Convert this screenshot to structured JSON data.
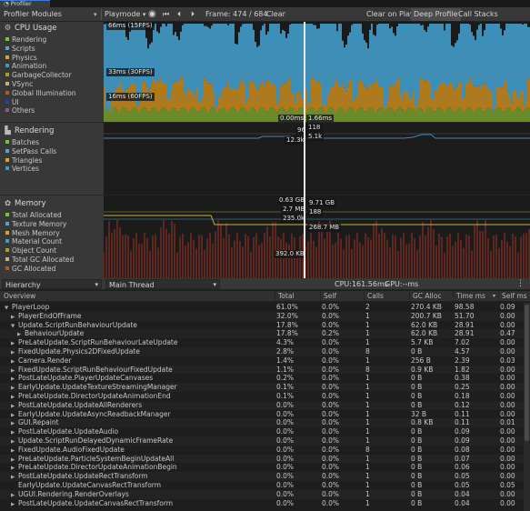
{
  "window": {
    "tab_title": "Profiler"
  },
  "toolbar": {
    "modules_label": "Profiler Modules",
    "mode_label": "Playmode",
    "frame_label": "Frame: 474 / 684",
    "clear_label": "Clear",
    "clear_on_play_label": "Clear on Play",
    "deep_profile_label": "Deep Profile",
    "call_stacks_label": "Call Stacks"
  },
  "modules": {
    "cpu": {
      "title": "CPU Usage",
      "legend": [
        {
          "label": "Rendering",
          "color": "#7fbf3f"
        },
        {
          "label": "Scripts",
          "color": "#5aa0d8"
        },
        {
          "label": "Physics",
          "color": "#d6a23a"
        },
        {
          "label": "Animation",
          "color": "#3a9fb5"
        },
        {
          "label": "GarbageCollector",
          "color": "#a7a02b"
        },
        {
          "label": "VSync",
          "color": "#c9b27a"
        },
        {
          "label": "Global Illumination",
          "color": "#b2582e"
        },
        {
          "label": "UI",
          "color": "#2c3f9e"
        },
        {
          "label": "Others",
          "color": "#8b5a8b"
        }
      ]
    },
    "rendering": {
      "title": "Rendering",
      "legend": [
        {
          "label": "Batches",
          "color": "#7fbf3f"
        },
        {
          "label": "SetPass Calls",
          "color": "#5aa0d8"
        },
        {
          "label": "Triangles",
          "color": "#d6a23a"
        },
        {
          "label": "Vertices",
          "color": "#3a9fb5"
        }
      ]
    },
    "memory": {
      "title": "Memory",
      "legend": [
        {
          "label": "Total Allocated",
          "color": "#7fbf3f"
        },
        {
          "label": "Texture Memory",
          "color": "#5aa0d8"
        },
        {
          "label": "Mesh Memory",
          "color": "#d6a23a"
        },
        {
          "label": "Material Count",
          "color": "#3a9fb5"
        },
        {
          "label": "Object Count",
          "color": "#a7a02b"
        },
        {
          "label": "Total GC Allocated",
          "color": "#c9b27a"
        },
        {
          "label": "GC Allocated",
          "color": "#b2582e"
        }
      ]
    }
  },
  "cpu_graph": {
    "lines": [
      "66ms (15FPS)",
      "33ms (30FPS)",
      "16ms (60FPS)"
    ],
    "selection": [
      "0.00ms",
      "1.66ms"
    ]
  },
  "rendering_graph": {
    "labels": [
      "96",
      "118",
      "12.3k",
      "5.1k"
    ]
  },
  "memory_graph": {
    "labels": [
      "0.63 GB",
      "9.71 GB",
      "2.7 MB",
      "188",
      "235.0k",
      "268.7 MB",
      "392.0 KB"
    ]
  },
  "colors": {
    "cpu_scripts": "#3d8fb8",
    "cpu_physics": "#b07a1a",
    "cpu_rendering": "#6b8a2a",
    "rendering_line": "#3f8ab0",
    "memory_line_yellow": "#c2b640",
    "memory_gc": "#b03a26"
  },
  "bottom_toolbar": {
    "view_label": "Hierarchy",
    "thread_label": "Main Thread",
    "cpu_text": "CPU:161.56ms",
    "gpu_text": "GPU:--ms"
  },
  "table": {
    "headers": [
      "Overview",
      "Total",
      "Self",
      "Calls",
      "GC Alloc",
      "Time ms",
      "Self ms"
    ],
    "rows": [
      {
        "name": "PlayerLoop",
        "indent": 0,
        "arrow": "▼",
        "total": "61.0%",
        "self": "0.0%",
        "calls": "2",
        "gc": "270.4 KB",
        "time": "98.58",
        "selfms": "0.09"
      },
      {
        "name": "PlayerEndOfFrame",
        "indent": 1,
        "arrow": "▶",
        "total": "32.0%",
        "self": "0.0%",
        "calls": "1",
        "gc": "200.7 KB",
        "time": "51.70",
        "selfms": "0.00"
      },
      {
        "name": "Update.ScriptRunBehaviourUpdate",
        "indent": 1,
        "arrow": "▼",
        "total": "17.8%",
        "self": "0.0%",
        "calls": "1",
        "gc": "62.0 KB",
        "time": "28.91",
        "selfms": "0.00"
      },
      {
        "name": "BehaviourUpdate",
        "indent": 2,
        "arrow": "▶",
        "total": "17.8%",
        "self": "0.2%",
        "calls": "1",
        "gc": "62.0 KB",
        "time": "28.91",
        "selfms": "0.47"
      },
      {
        "name": "PreLateUpdate.ScriptRunBehaviourLateUpdate",
        "indent": 1,
        "arrow": "▶",
        "total": "4.3%",
        "self": "0.0%",
        "calls": "1",
        "gc": "5.7 KB",
        "time": "7.02",
        "selfms": "0.00"
      },
      {
        "name": "FixedUpdate.Physics2DFixedUpdate",
        "indent": 1,
        "arrow": "▶",
        "total": "2.8%",
        "self": "0.0%",
        "calls": "8",
        "gc": "0 B",
        "time": "4.57",
        "selfms": "0.00"
      },
      {
        "name": "Camera.Render",
        "indent": 1,
        "arrow": "▶",
        "total": "1.4%",
        "self": "0.0%",
        "calls": "1",
        "gc": "256 B",
        "time": "2.39",
        "selfms": "0.03"
      },
      {
        "name": "FixedUpdate.ScriptRunBehaviourFixedUpdate",
        "indent": 1,
        "arrow": "▶",
        "total": "1.1%",
        "self": "0.0%",
        "calls": "8",
        "gc": "0.9 KB",
        "time": "1.82",
        "selfms": "0.00"
      },
      {
        "name": "PostLateUpdate.PlayerUpdateCanvases",
        "indent": 1,
        "arrow": "▶",
        "total": "0.2%",
        "self": "0.0%",
        "calls": "1",
        "gc": "0 B",
        "time": "0.38",
        "selfms": "0.00"
      },
      {
        "name": "EarlyUpdate.UpdateTextureStreamingManager",
        "indent": 1,
        "arrow": "▶",
        "total": "0.1%",
        "self": "0.0%",
        "calls": "1",
        "gc": "0 B",
        "time": "0.25",
        "selfms": "0.00"
      },
      {
        "name": "PreLateUpdate.DirectorUpdateAnimationEnd",
        "indent": 1,
        "arrow": "▶",
        "total": "0.1%",
        "self": "0.0%",
        "calls": "1",
        "gc": "0 B",
        "time": "0.18",
        "selfms": "0.00"
      },
      {
        "name": "PostLateUpdate.UpdateAllRenderers",
        "indent": 1,
        "arrow": "▶",
        "total": "0.0%",
        "self": "0.0%",
        "calls": "1",
        "gc": "0 B",
        "time": "0.12",
        "selfms": "0.00"
      },
      {
        "name": "EarlyUpdate.UpdateAsyncReadbackManager",
        "indent": 1,
        "arrow": "▶",
        "total": "0.0%",
        "self": "0.0%",
        "calls": "1",
        "gc": "32 B",
        "time": "0.11",
        "selfms": "0.00"
      },
      {
        "name": "GUI.Repaint",
        "indent": 1,
        "arrow": "▶",
        "total": "0.0%",
        "self": "0.0%",
        "calls": "1",
        "gc": "0.8 KB",
        "time": "0.11",
        "selfms": "0.01"
      },
      {
        "name": "PostLateUpdate.UpdateAudio",
        "indent": 1,
        "arrow": "▶",
        "total": "0.0%",
        "self": "0.0%",
        "calls": "1",
        "gc": "0 B",
        "time": "0.09",
        "selfms": "0.00"
      },
      {
        "name": "Update.ScriptRunDelayedDynamicFrameRate",
        "indent": 1,
        "arrow": "▶",
        "total": "0.0%",
        "self": "0.0%",
        "calls": "1",
        "gc": "0 B",
        "time": "0.09",
        "selfms": "0.00"
      },
      {
        "name": "FixedUpdate.AudioFixedUpdate",
        "indent": 1,
        "arrow": "▶",
        "total": "0.0%",
        "self": "0.0%",
        "calls": "8",
        "gc": "0 B",
        "time": "0.08",
        "selfms": "0.00"
      },
      {
        "name": "PreLateUpdate.ParticleSystemBeginUpdateAll",
        "indent": 1,
        "arrow": "▶",
        "total": "0.0%",
        "self": "0.0%",
        "calls": "1",
        "gc": "0 B",
        "time": "0.07",
        "selfms": "0.00"
      },
      {
        "name": "PreLateUpdate.DirectorUpdateAnimationBegin",
        "indent": 1,
        "arrow": "▶",
        "total": "0.0%",
        "self": "0.0%",
        "calls": "1",
        "gc": "0 B",
        "time": "0.06",
        "selfms": "0.00"
      },
      {
        "name": "PostLateUpdate.UpdateRectTransform",
        "indent": 1,
        "arrow": "▶",
        "total": "0.0%",
        "self": "0.0%",
        "calls": "1",
        "gc": "0 B",
        "time": "0.05",
        "selfms": "0.00"
      },
      {
        "name": "EarlyUpdate.UpdateCanvasRectTransform",
        "indent": 1,
        "arrow": "",
        "total": "0.0%",
        "self": "0.0%",
        "calls": "1",
        "gc": "0 B",
        "time": "0.05",
        "selfms": "0.05"
      },
      {
        "name": "UGUI.Rendering.RenderOverlays",
        "indent": 1,
        "arrow": "▶",
        "total": "0.0%",
        "self": "0.0%",
        "calls": "1",
        "gc": "0 B",
        "time": "0.04",
        "selfms": "0.00"
      },
      {
        "name": "PostLateUpdate.UpdateCanvasRectTransform",
        "indent": 1,
        "arrow": "▶",
        "total": "0.0%",
        "self": "0.0%",
        "calls": "1",
        "gc": "0 B",
        "time": "0.04",
        "selfms": "0.00"
      }
    ]
  }
}
